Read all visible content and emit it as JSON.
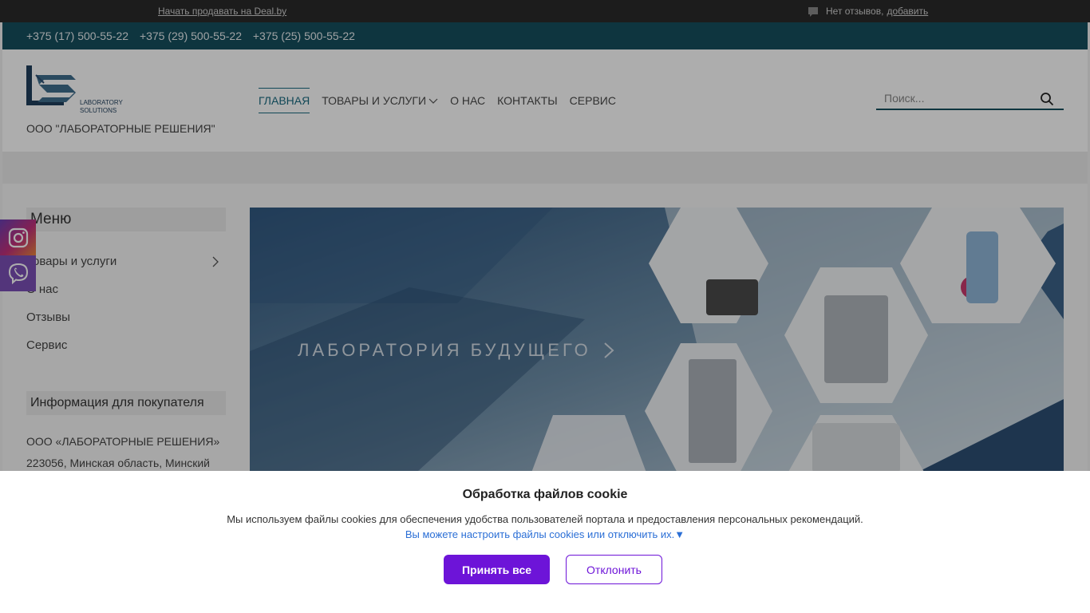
{
  "topbar": {
    "sell_link": "Начать продавать на Deal.by",
    "reviews_text": "Нет отзывов,",
    "reviews_add": "добавить"
  },
  "phones": [
    "+375 (17) 500-55-22",
    "+375 (29) 500-55-22",
    "+375 (25) 500-55-22"
  ],
  "header": {
    "logo_line1": "LABORATORY",
    "logo_line2": "SOLUTIONS",
    "company_name": "ООО \"ЛАБОРАТОРНЫЕ РЕШЕНИЯ\"",
    "nav": [
      "ГЛАВНАЯ",
      "ТОВАРЫ И УСЛУГИ",
      "О НАС",
      "КОНТАКТЫ",
      "СЕРВИС"
    ],
    "search_placeholder": "Поиск..."
  },
  "sidebar": {
    "menu_title": "Меню",
    "menu_items": [
      "Товары и услуги",
      "О нас",
      "Отзывы",
      "Сервис"
    ],
    "info_title": "Информация для покупателя",
    "info_lines": [
      "ООО «ЛАБОРАТОРНЫЕ РЕШЕНИЯ»",
      "223056, Минская область, Минский"
    ]
  },
  "banner": {
    "text": "ЛАБОРАТОРИЯ БУДУЩЕГО"
  },
  "cookie": {
    "title": "Обработка файлов cookie",
    "text": "Мы используем файлы cookies для обеспечения удобства пользователей портала и предоставления персональных рекомендаций.",
    "link": "Вы можете настроить файлы cookies или отключить их.▼",
    "accept_label": "Принять все",
    "decline_label": "Отклонить"
  },
  "colors": {
    "brand": "#154e5e",
    "accent_button": "#6d14d8",
    "link": "#2b6fd6"
  }
}
